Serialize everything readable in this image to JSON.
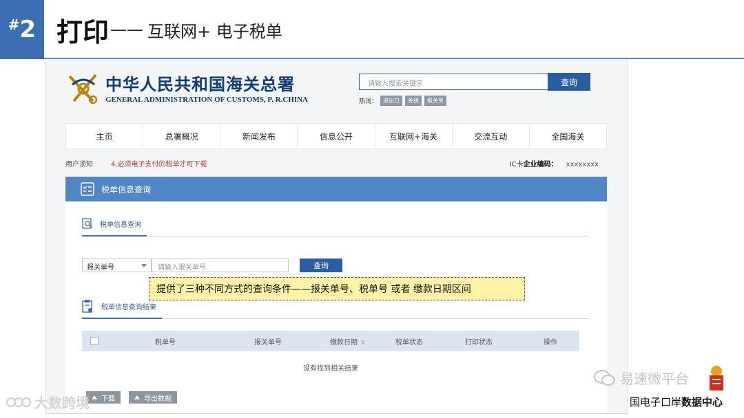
{
  "slide": {
    "number_prefix": "#",
    "number": "2",
    "title": "打印",
    "dash": "——",
    "subtitle": "互联网+ 电子税单"
  },
  "site": {
    "name_cn": "中华人民共和国海关总署",
    "name_en": "GENERAL ADMINISTRATION OF CUSTOMS, P. R.CHINA",
    "search_placeholder": "请输入搜索关键字",
    "search_button": "查询",
    "hot_label": "热词：",
    "hot_tags": [
      "进出口",
      "关税",
      "报关单"
    ]
  },
  "nav": {
    "items": [
      "主页",
      "总署概况",
      "新闻发布",
      "信息公开",
      "互联网+海关",
      "交流互动",
      "全国海关"
    ]
  },
  "notice": {
    "label": "用户须知",
    "text": "4.必须电子支付的税单才可下载",
    "ic_card_prefix": "IC卡",
    "ic_card_label": "企业编码：",
    "ic_card_value": "xxxxxxxx"
  },
  "panel": {
    "title": "税单信息查询",
    "tab_query": "税单信息查询",
    "select_value": "报关单号",
    "input_placeholder": "请输入报关单号",
    "query_button": "查询",
    "tab_result": "税单信息查询结果",
    "columns": [
      "税单号",
      "报关单号",
      "缴款日期",
      "税单状态",
      "打印状态",
      "操作"
    ],
    "sort_glyph": "⇕",
    "empty_text": "没有找到相关结果",
    "download_button": "下载",
    "export_button": "导出数据"
  },
  "callout": {
    "text": "提供了三种不同方式的查询条件——报关单号、税单号 或者 缴款日期区间"
  },
  "watermarks": {
    "left": "大数跨境",
    "wechat": "易速微平台",
    "bottom_normal": "国电子口岸",
    "bottom_bold": "数据中心"
  }
}
